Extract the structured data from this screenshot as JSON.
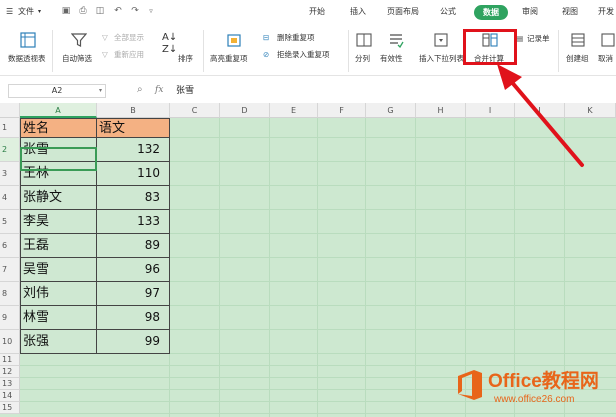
{
  "menubar": {
    "file_label": "文件",
    "tabs": [
      "开始",
      "插入",
      "页面布局",
      "公式",
      "数据",
      "审阅",
      "视图",
      "开发"
    ],
    "active_tab": "数据"
  },
  "ribbon": {
    "pivot_table": "数据透视表",
    "auto_filter": "自动筛选",
    "show_all": "全部显示",
    "reapply": "重新应用",
    "sort": "排序",
    "highlight_dup": "高亮重复项",
    "delete_dup": "删除重复项",
    "reject_dup": "拒绝录入重复项",
    "split_column": "分列",
    "validity": "有效性",
    "insert_dropdown": "插入下拉列表",
    "consolidate": "合并计算",
    "record_form": "记录单",
    "create_group": "创建组",
    "ungroup": "取消"
  },
  "formula_bar": {
    "name_box": "A2",
    "fx": "fx",
    "content": "张雪"
  },
  "sheet": {
    "columns": [
      "A",
      "B",
      "C",
      "D",
      "E",
      "F",
      "G",
      "H",
      "I",
      "J",
      "K"
    ],
    "active_column": "A",
    "rows": [
      "1",
      "2",
      "3",
      "4",
      "5",
      "6",
      "7",
      "8",
      "9",
      "10",
      "11",
      "12",
      "13",
      "14",
      "15"
    ],
    "active_row": "2",
    "header": [
      "姓名",
      "语文"
    ],
    "data": [
      [
        "张雪",
        "132"
      ],
      [
        "王林",
        "110"
      ],
      [
        "张静文",
        "83"
      ],
      [
        "李昊",
        "133"
      ],
      [
        "王磊",
        "89"
      ],
      [
        "吴雪",
        "96"
      ],
      [
        "刘伟",
        "97"
      ],
      [
        "林雪",
        "98"
      ],
      [
        "张强",
        "99"
      ]
    ]
  },
  "colors": {
    "accent": "#2fa360",
    "header_fill": "#f4b183",
    "sheet_bg": "#cde8d0",
    "annotation": "#e0121b"
  },
  "watermark": {
    "title": "Office教程网",
    "url": "www.office26.com"
  }
}
